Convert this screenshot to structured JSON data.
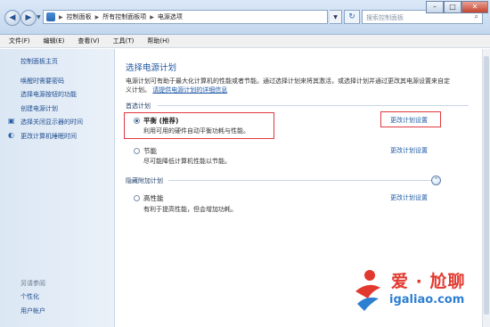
{
  "address": {
    "crumbs": [
      "控制面板",
      "所有控制面板项",
      "电源选项"
    ],
    "search_placeholder": "搜索控制面板"
  },
  "menu": [
    "文件(F)",
    "编辑(E)",
    "查看(V)",
    "工具(T)",
    "帮助(H)"
  ],
  "sidebar": {
    "home": "控制面板主页",
    "links": [
      "唤醒时需要密码",
      "选择电源按钮的功能",
      "创建电源计划",
      "选择关闭显示器的时间",
      "更改计算机睡眠时间"
    ],
    "see_also": "另请参阅",
    "bottom_links": [
      "个性化",
      "用户帐户"
    ]
  },
  "main": {
    "heading": "选择电源计划",
    "description": "电源计划可有助于最大化计算机的性能或者节能。通过选择计划来将其激活，或选择计划并通过更改其电源设置来自定义计划。",
    "description_link": "请提供电源计划的详细信息",
    "preferred_section": "首选计划",
    "hidden_section": "隐藏附加计划",
    "plans": [
      {
        "name": "平衡 (推荐)",
        "desc": "利用可用的硬件自动平衡功耗与性能。",
        "change": "更改计划设置",
        "selected": true
      },
      {
        "name": "节能",
        "desc": "尽可能降低计算机性能以节能。",
        "change": "更改计划设置",
        "selected": false
      },
      {
        "name": "高性能",
        "desc": "有利于提高性能，但会增加功耗。",
        "change": "更改计划设置",
        "selected": false
      }
    ]
  },
  "watermark": {
    "line1": "爱 · 尬聊",
    "line2": "igaliao.com"
  },
  "colors": {
    "link": "#1f5aa6",
    "highlight": "#e0383f",
    "heading": "#1f56a0"
  }
}
